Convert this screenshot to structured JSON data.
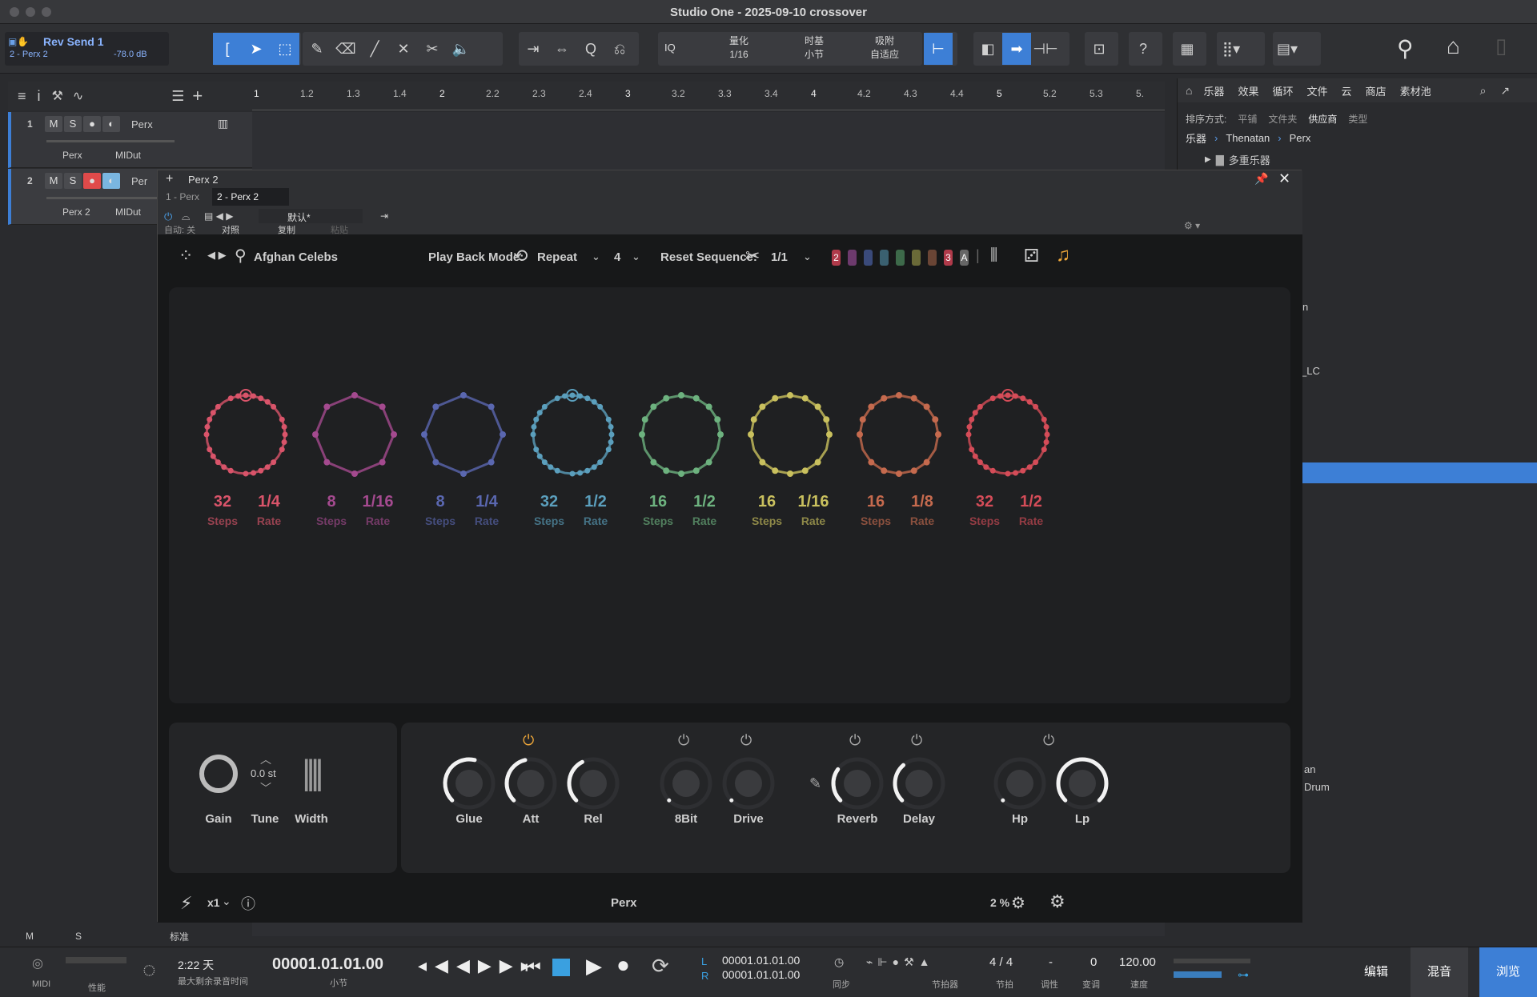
{
  "app": {
    "title": "Studio One - 2025-09-10 crossover"
  },
  "toolbar": {
    "send_name": "Rev Send 1",
    "send_track": "2 - Perx 2",
    "send_db": "-78.0 dB",
    "quantize_label": "量化",
    "quantize_value": "1/16",
    "timebase_label": "时基",
    "timebase_value": "小节",
    "snap_label": "吸附",
    "snap_value": "自适应",
    "iq": "IQ"
  },
  "tracks": [
    {
      "num": "1",
      "name": "Perx",
      "inst": "Perx",
      "midi": "MIDut"
    },
    {
      "num": "2",
      "name": "Per",
      "inst": "Perx 2",
      "midi": "MIDut"
    }
  ],
  "ruler": [
    "1",
    "1.2",
    "1.3",
    "1.4",
    "2",
    "2.2",
    "2.3",
    "2.4",
    "3",
    "3.2",
    "3.3",
    "3.4",
    "4",
    "4.2",
    "4.3",
    "4.4",
    "5",
    "5.2",
    "5.3",
    "5."
  ],
  "browser": {
    "tabs": [
      "乐器",
      "效果",
      "循环",
      "文件",
      "云",
      "商店",
      "素材池"
    ],
    "sort_label": "排序方式:",
    "sort_opts": [
      "平铺",
      "文件夹",
      "供应商",
      "类型"
    ],
    "crumbs": [
      "乐器",
      "Thenatan",
      "Perx"
    ],
    "folder": "多重乐器",
    "partial": [
      "n",
      "_LC",
      "an",
      "Drum"
    ]
  },
  "plugin_window": {
    "tab_add": "Perx 2",
    "tabs": [
      "1 - Perx",
      "2 - Perx 2"
    ],
    "preset": "默认*",
    "auto": "自动: 关",
    "compare": "对照",
    "copy": "复制",
    "paste": "粘贴"
  },
  "plugin": {
    "preset_name": "Afghan Celebs",
    "playback_label": "Play Back Mode:",
    "playback_value": "Repeat",
    "count": "4",
    "reset_label": "Reset Sequence:",
    "reset_value": "1/1",
    "slot_2": "2",
    "slot_3": "3",
    "slot_a": "A",
    "rings": [
      {
        "steps": "32",
        "rate": "1/4",
        "color": "#d9546a"
      },
      {
        "steps": "8",
        "rate": "1/16",
        "color": "#a44a8f"
      },
      {
        "steps": "8",
        "rate": "1/4",
        "color": "#5a67b0"
      },
      {
        "steps": "32",
        "rate": "1/2",
        "color": "#5b9fbd"
      },
      {
        "steps": "16",
        "rate": "1/2",
        "color": "#6db27f"
      },
      {
        "steps": "16",
        "rate": "1/16",
        "color": "#c9c05e"
      },
      {
        "steps": "16",
        "rate": "1/8",
        "color": "#c56a4e"
      },
      {
        "steps": "32",
        "rate": "1/2",
        "color": "#d44c58"
      }
    ],
    "steps_label": "Steps",
    "rate_label": "Rate",
    "gain": "Gain",
    "tune": "Tune",
    "tune_value": "0.0 st",
    "width": "Width",
    "knobs": [
      {
        "name": "Glue",
        "level": 0.55
      },
      {
        "name": "Att",
        "level": 0.45
      },
      {
        "name": "Rel",
        "level": 0.4
      },
      {
        "name": "8Bit",
        "level": 0.0
      },
      {
        "name": "Drive",
        "level": 0.0
      },
      {
        "name": "Reverb",
        "level": 0.3
      },
      {
        "name": "Delay",
        "level": 0.35
      },
      {
        "name": "Hp",
        "level": 0.0
      },
      {
        "name": "Lp",
        "level": 1.0
      }
    ],
    "footer_mult": "x1",
    "footer_name": "Perx",
    "cpu": "2 %"
  },
  "transport": {
    "midi": "MIDI",
    "perf": "性能",
    "days": "2:22 天",
    "rec_time": "最大剩余录音时间",
    "pos": "00001.01.01.00",
    "pos_unit": "小节",
    "l": "00001.01.01.00",
    "r": "00001.01.01.00",
    "l_lab": "L",
    "r_lab": "R",
    "sync": "同步",
    "metro": "节拍器",
    "sig": "4 / 4",
    "sig_lab": "节拍",
    "key": "-",
    "key_lab": "调性",
    "shift": "0",
    "shift_lab": "变调",
    "tempo": "120.00",
    "tempo_lab": "速度",
    "edit": "编辑",
    "mix": "混音",
    "browse": "浏览"
  },
  "mix_footer": {
    "m": "M",
    "s": "S",
    "std": "标准"
  }
}
